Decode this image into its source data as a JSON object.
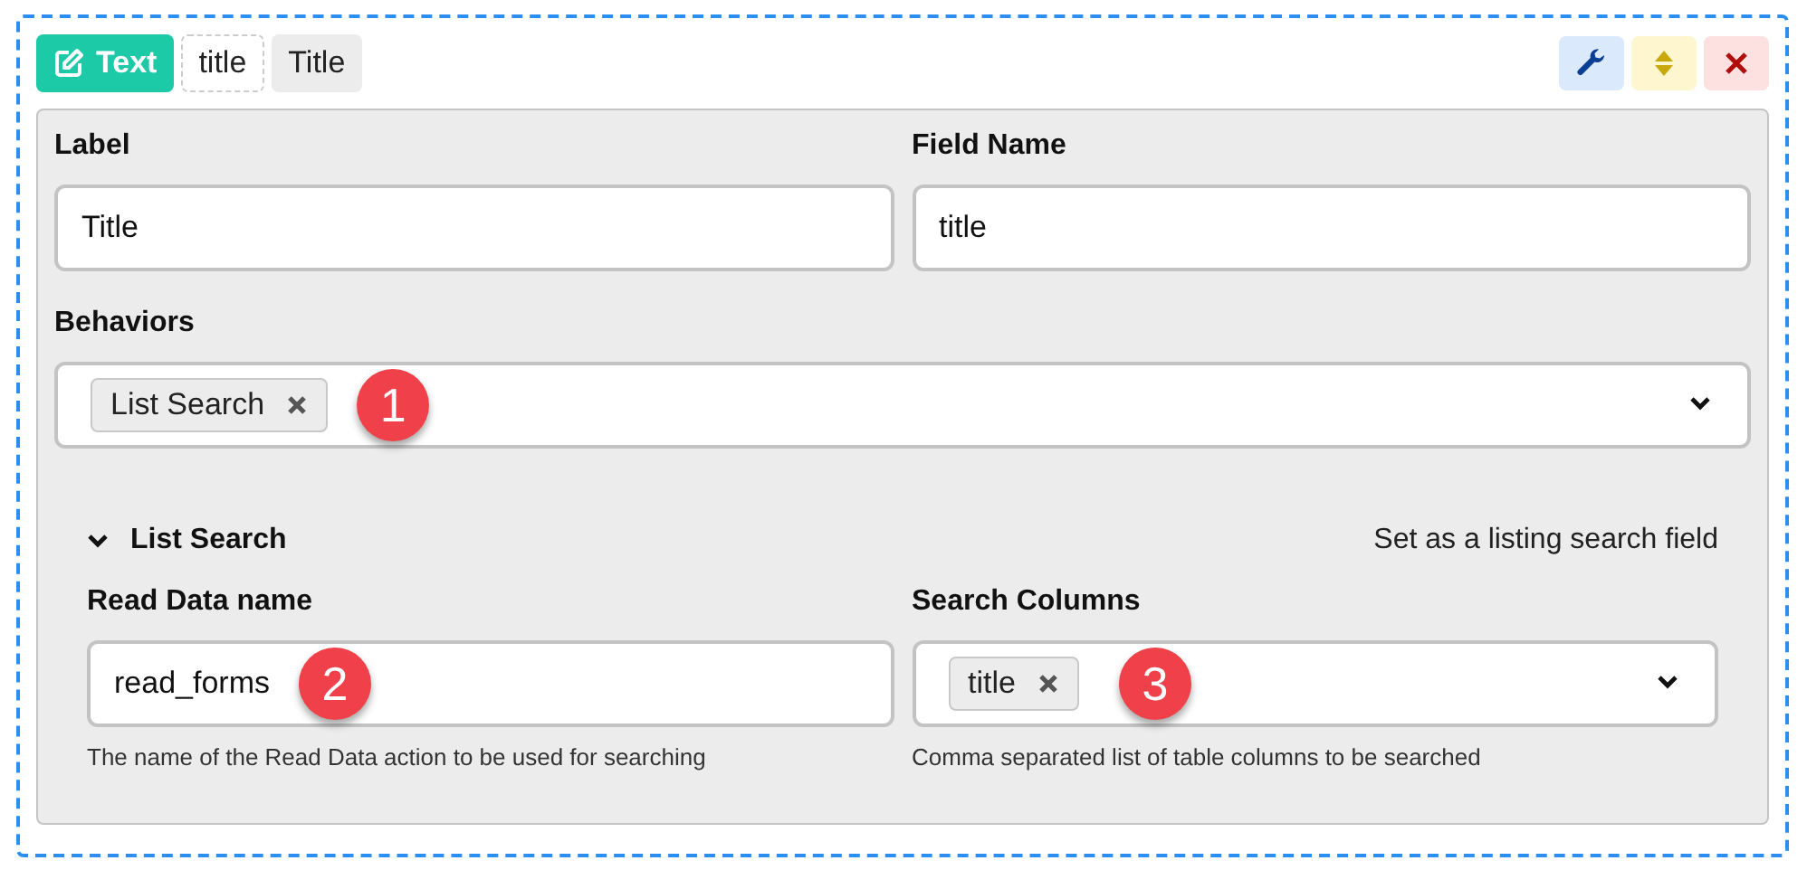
{
  "header": {
    "type_badge": "Text",
    "name_tag": "title",
    "label_tag": "Title"
  },
  "fields": [
    {
      "label": "Label",
      "value": "Title"
    },
    {
      "label": "Field Name",
      "value": "title"
    }
  ],
  "behaviors": {
    "label": "Behaviors",
    "tags": [
      {
        "text": "List Search",
        "callout": "1"
      }
    ]
  },
  "section": {
    "title": "List Search",
    "expanded": true,
    "description": "Set as a listing search field",
    "fields": [
      {
        "kind": "input",
        "label": "Read Data name",
        "value": "read_forms",
        "callout": "2",
        "help": "The name of the Read Data action to be used for searching"
      },
      {
        "kind": "select",
        "label": "Search Columns",
        "tags": [
          "title"
        ],
        "callout": "3",
        "help": "Comma separated list of table columns to be searched"
      }
    ]
  }
}
